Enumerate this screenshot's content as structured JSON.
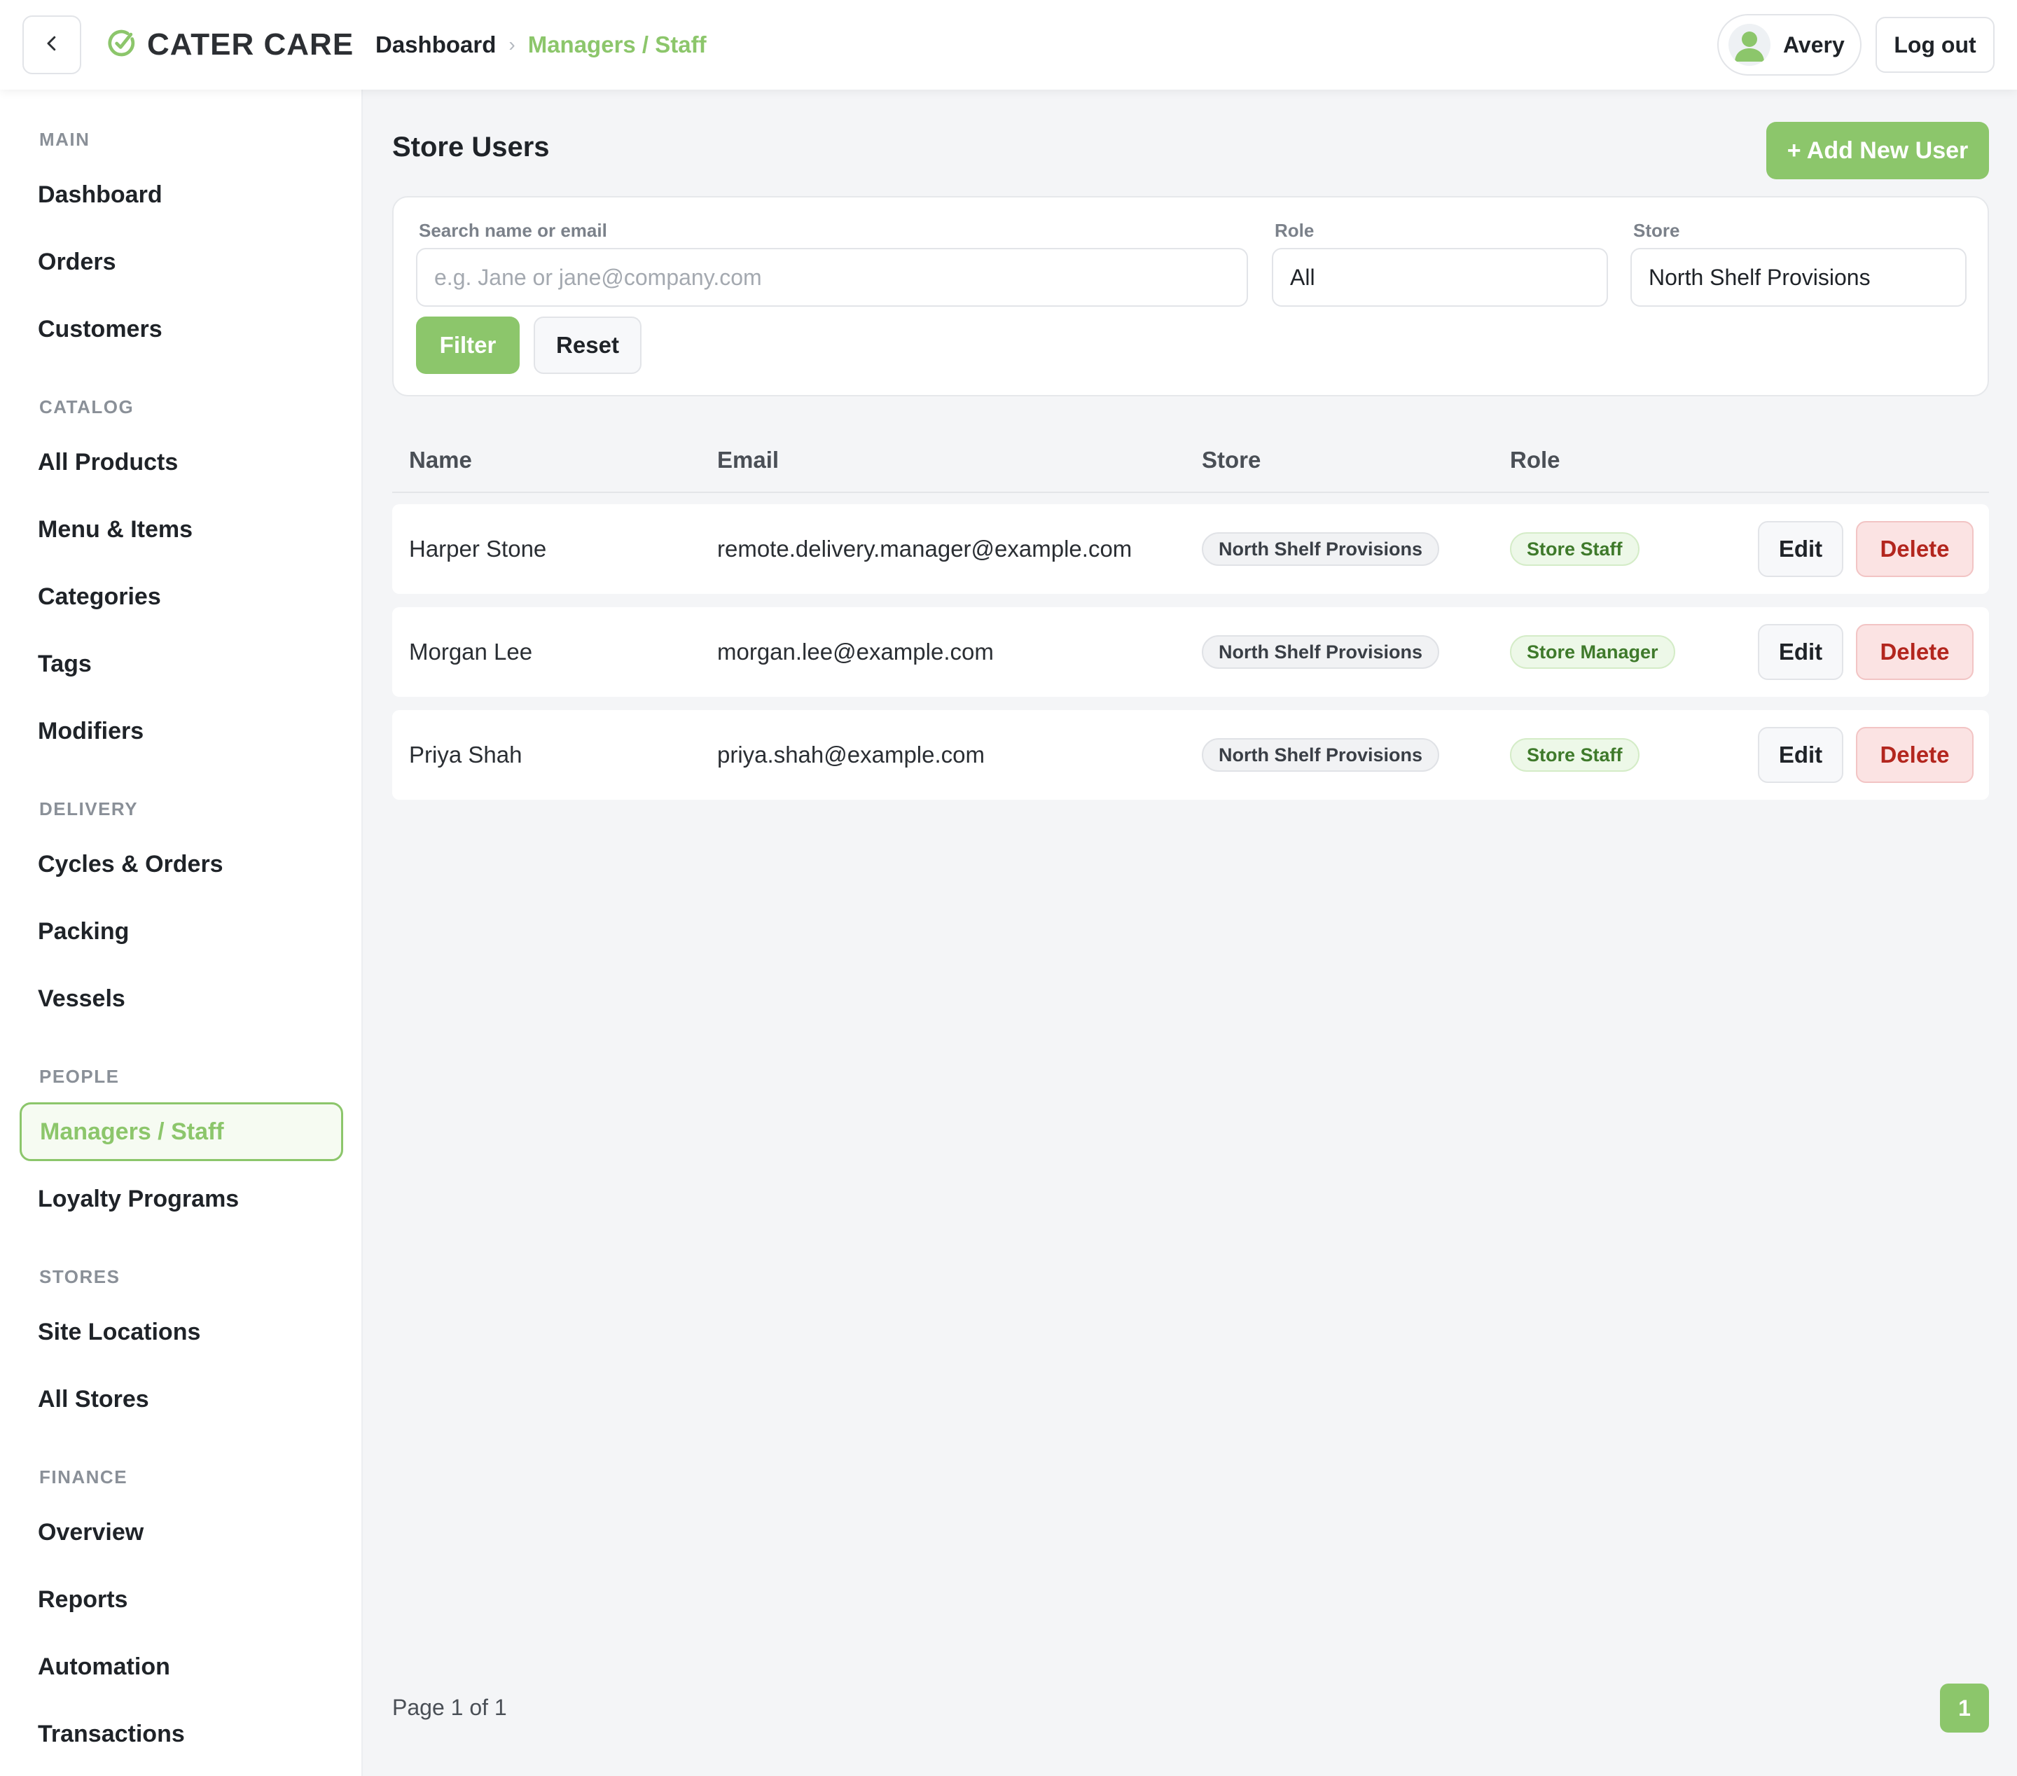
{
  "colors": {
    "accent": "#8cc66b",
    "danger": "#b3261e",
    "danger_bg": "#fbe3e3",
    "page_bg": "#f4f5f7"
  },
  "header": {
    "back_icon": "chevron-left-icon",
    "brand": {
      "icon": "check-circle-icon",
      "name": "CATER CARE"
    },
    "breadcrumb": {
      "home": "Dashboard",
      "separator": "›",
      "current": "Managers / Staff"
    },
    "user": {
      "avatar_icon": "user-avatar-icon",
      "name": "Avery"
    },
    "logout_label": "Log out"
  },
  "sidebar": {
    "sections": [
      {
        "title": "MAIN",
        "items": [
          "Dashboard",
          "Orders",
          "Customers"
        ]
      },
      {
        "title": "CATALOG",
        "items": [
          "All Products",
          "Menu & Items",
          "Categories",
          "Tags",
          "Modifiers"
        ]
      },
      {
        "title": "DELIVERY",
        "items": [
          "Cycles & Orders",
          "Packing",
          "Vessels"
        ]
      },
      {
        "title": "PEOPLE",
        "items": [
          "Managers / Staff",
          "Loyalty Programs"
        ]
      },
      {
        "title": "STORES",
        "items": [
          "Site Locations",
          "All Stores"
        ]
      },
      {
        "title": "FINANCE",
        "items": [
          "Overview",
          "Reports",
          "Automation",
          "Transactions"
        ]
      }
    ],
    "active_item": "Managers / Staff"
  },
  "main": {
    "title": "Store Users",
    "add_button": "+ Add New User",
    "filters": {
      "search": {
        "label": "Search name or email",
        "placeholder": "e.g. Jane or jane@company.com",
        "value": ""
      },
      "role": {
        "label": "Role",
        "value": "All"
      },
      "store": {
        "label": "Store",
        "value": "North Shelf Provisions"
      },
      "filter_button": "Filter",
      "reset_button": "Reset"
    },
    "table": {
      "columns": [
        "Name",
        "Email",
        "Store",
        "Role"
      ],
      "rows": [
        {
          "name": "Harper Stone",
          "email": "remote.delivery.manager@example.com",
          "store": "North Shelf Provisions",
          "role": "Store Staff"
        },
        {
          "name": "Morgan Lee",
          "email": "morgan.lee@example.com",
          "store": "North Shelf Provisions",
          "role": "Store Manager"
        },
        {
          "name": "Priya Shah",
          "email": "priya.shah@example.com",
          "store": "North Shelf Provisions",
          "role": "Store Staff"
        }
      ],
      "edit_label": "Edit",
      "delete_label": "Delete"
    },
    "pagination": {
      "info": "Page 1 of 1",
      "current_page": "1"
    }
  }
}
